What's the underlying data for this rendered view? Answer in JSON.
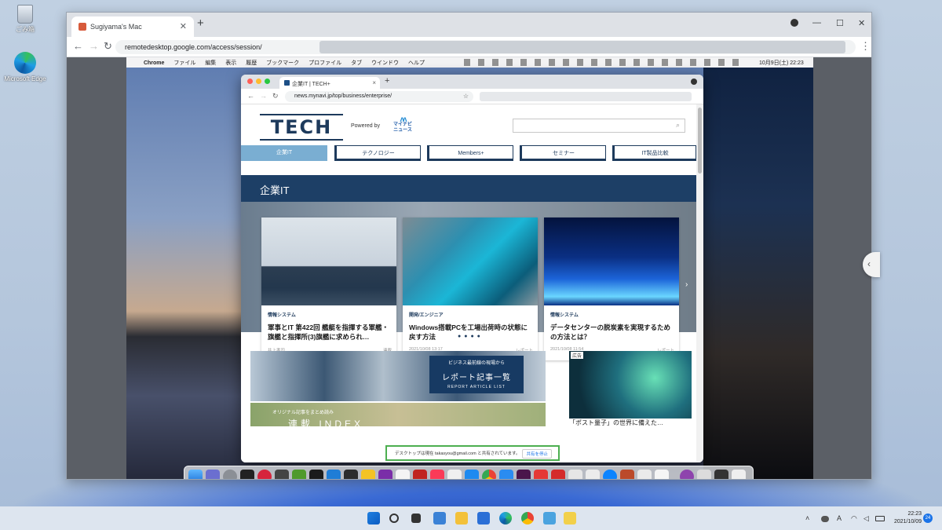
{
  "desktop": {
    "icons": [
      {
        "label": "ごみ箱"
      },
      {
        "label": "Microsoft Edge"
      }
    ]
  },
  "chrome": {
    "tab_title": "Sugiyama's Mac",
    "tab_close": "✕",
    "new_tab": "+",
    "minimize": "—",
    "maximize": "☐",
    "close": "✕",
    "back": "←",
    "forward": "→",
    "reload": "↻",
    "url": "remotedesktop.google.com/access/session/",
    "menu": "⋮"
  },
  "mac_menubar": {
    "apple": "",
    "app_name": "Chrome",
    "menus": [
      "ファイル",
      "編集",
      "表示",
      "履歴",
      "ブックマーク",
      "プロファイル",
      "タブ",
      "ウインドウ",
      "ヘルプ"
    ],
    "datetime": "10月9日(土)  22:23"
  },
  "mac_browser": {
    "tab_title": "企業IT | TECH+",
    "tab_close": "×",
    "new_tab": "+",
    "url": "news.mynavi.jp/top/business/enterprise/",
    "back": "←",
    "forward": "→",
    "reload": "↻",
    "star": "☆"
  },
  "site": {
    "logo": "TECH",
    "powered_by": "Powered by",
    "partner_line1": "マイナビ",
    "partner_line2": "ニュース",
    "search_icon": "⌕",
    "nav": [
      "企業IT",
      "テクノロジー",
      "Members+",
      "セミナー",
      "IT製品比較"
    ],
    "banner": "企業IT",
    "cards": [
      {
        "category": "情報システム",
        "title": "軍事とIT 第422回 艦艇を指揮する軍艦・旗艦と指揮所(3)旗艦に求められ…",
        "author": "井上孝司",
        "type": "連載"
      },
      {
        "category": "開発/エンジニア",
        "title": "Windows搭載PCを工場出荷時の状態に戻す方法",
        "date": "2021/10/08 13:17",
        "type": "レポート"
      },
      {
        "category": "情報システム",
        "title": "データセンターの脱炭素を実現するための方法とは？",
        "date": "2021/10/08 11:54",
        "type": "レポート"
      }
    ],
    "next": "›",
    "dots": "●●●●",
    "report_line1": "ビジネス最前線の現場から",
    "report_line2": "レポート記事一覧",
    "report_line3": "REPORT ARTICLE LIST",
    "index_small": "オリジナル記事をまとめ読み",
    "index_big": "連載 INDEX",
    "ad_label": "広告",
    "ad_caption": "「ポスト量子」の世界に備えた…",
    "share_text": "デスクトップは現在 takasyou@gmail.com と共有されています。",
    "share_stop": "共有を停止"
  },
  "taskbar": {
    "time": "22:23",
    "date": "2021/10/09",
    "notifications": "24",
    "ime": "A"
  },
  "side_handle": "‹"
}
